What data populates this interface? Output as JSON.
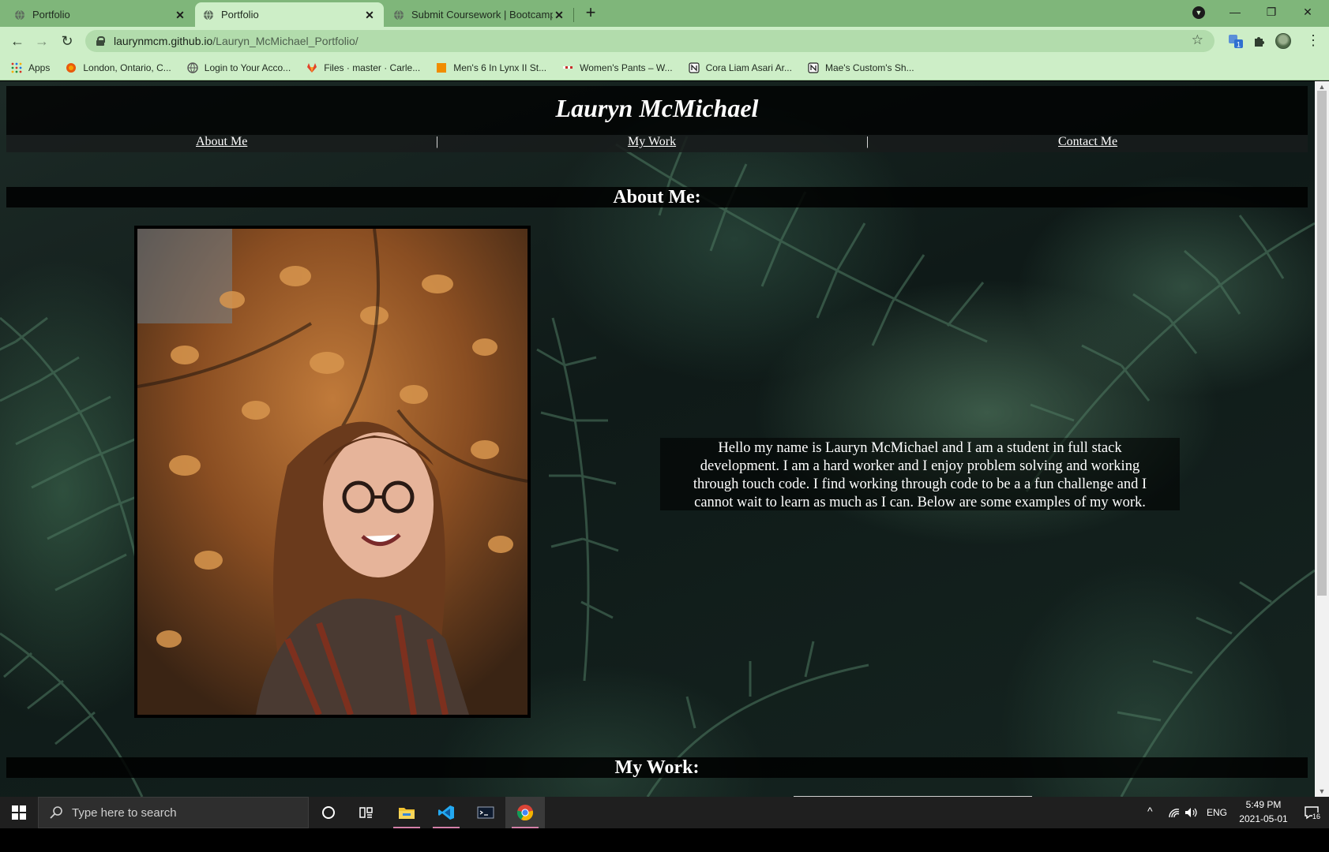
{
  "browser": {
    "tabs": [
      {
        "title": "Portfolio",
        "active": false
      },
      {
        "title": "Portfolio",
        "active": true
      },
      {
        "title": "Submit Coursework | Bootcamp S",
        "active": false
      }
    ],
    "new_tab_symbol": "+",
    "window_controls": {
      "minimize": "—",
      "restore": "❐",
      "close": "✕"
    },
    "url_host": "laurynmcm.github.io",
    "url_path": "/Lauryn_McMichael_Portfolio/",
    "extension_badge": "1",
    "bookmarks": [
      {
        "label": "Apps",
        "icon": "apps-grid-icon"
      },
      {
        "label": "London, Ontario, C...",
        "icon": "weather-icon"
      },
      {
        "label": "Login to Your Acco...",
        "icon": "globe-icon"
      },
      {
        "label": "Files · master · Carle...",
        "icon": "gitlab-icon"
      },
      {
        "label": "Men's 6 In Lynx II St...",
        "icon": "orange-square-icon"
      },
      {
        "label": "Women's Pants – W...",
        "icon": "store-icon"
      },
      {
        "label": "Cora Liam Asari Ar...",
        "icon": "notion-icon"
      },
      {
        "label": "Mae's Custom's Sh...",
        "icon": "notion-icon"
      }
    ]
  },
  "site": {
    "title": "Lauryn McMichael",
    "nav": [
      "About Me",
      "My Work",
      "Contact Me"
    ],
    "nav_separator": "|",
    "about_heading": "About Me:",
    "about_text_lines": [
      "Hello my name is Lauryn McMichael and I am a student in full stack",
      "development. I am a hard worker and I enjoy problem solving and working",
      "through touch code. I find working through code to be a a fun challenge and I",
      "cannot wait to learn as much as I can. Below are some examples of my work."
    ],
    "work_heading": "My Work:"
  },
  "taskbar": {
    "search_placeholder": "Type here to search",
    "language": "ENG",
    "time": "5:49 PM",
    "date": "2021-05-01",
    "notification_count": "16"
  },
  "colors": {
    "chrome_frame": "#7fb67a",
    "chrome_toolbar": "#cdeec7",
    "taskbar": "#1f1f1f"
  }
}
